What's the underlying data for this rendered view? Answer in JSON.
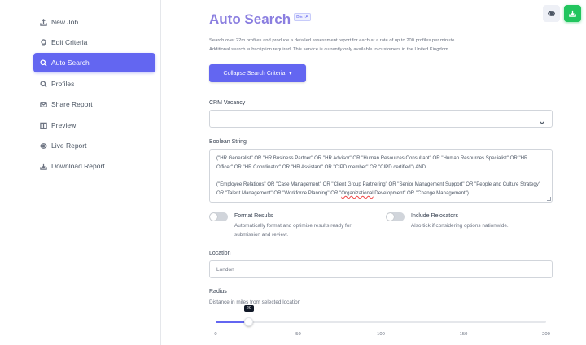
{
  "sidebar": {
    "items": [
      {
        "label": "New Job",
        "icon": "upload-icon"
      },
      {
        "label": "Edit Criteria",
        "icon": "lightbulb-icon"
      },
      {
        "label": "Auto Search",
        "icon": "search-icon",
        "active": true
      },
      {
        "label": "Profiles",
        "icon": "search-icon"
      },
      {
        "label": "Share Report",
        "icon": "mail-icon"
      },
      {
        "label": "Preview",
        "icon": "book-icon"
      },
      {
        "label": "Live Report",
        "icon": "eye-icon"
      },
      {
        "label": "Download Report",
        "icon": "download-icon"
      }
    ]
  },
  "header": {
    "title": "Auto Search",
    "badge": "BETA",
    "description_line1": "Search over 22m profiles and produce a detailed assessment report for each at a rate of up to 200 profiles per minute.",
    "description_line2": "Additional search subscription required. This service is currently only available to customers in the United Kingdom.",
    "collapse_label": "Collapse Search Criteria",
    "collapse_caret": "▾"
  },
  "form": {
    "crm_label": "CRM Vacancy",
    "crm_value": "",
    "boolean_label": "Boolean String",
    "boolean_para1": "(\"HR Generalist\" OR \"HR Business Partner\" OR \"HR Advisor\" OR \"Human Resources Consultant\" OR \"Human Resources Specialist\" OR \"HR Officer\" OR \"HR Coordinator\" OR \"HR Assistant\" OR \"CIPD member\" OR \"CIPD certified\") AND",
    "boolean_para2_a": "(\"Employee Relations\" OR \"Case Management\" OR \"Client Group Partnering\" OR \"Senior Management Support\" OR \"People and Culture Strategy\" OR \"Talent Management\" OR \"Workforce Planning\" OR \"",
    "boolean_para2_underlined": "Organizational",
    "boolean_para2_b": " Development\" OR \"Change Management\")",
    "format_results_title": "Format Results",
    "format_results_desc": "Automatically format and optimise results ready for submission and review.",
    "format_results_on": false,
    "relocators_title": "Include Relocators",
    "relocators_desc": "Also tick if considering options nationwide.",
    "relocators_on": false,
    "location_label": "Location",
    "location_placeholder": "London",
    "radius_label": "Radius",
    "radius_desc": "Distance in miles from selected location",
    "radius_value": 20,
    "radius_value_label": "20",
    "radius_min": 0,
    "radius_max": 200,
    "radius_ticks": [
      "0",
      "50",
      "100",
      "150",
      "200"
    ]
  },
  "top_actions": [
    {
      "icon": "eye-off-icon"
    },
    {
      "icon": "download-icon"
    }
  ],
  "colors": {
    "accent": "#6366f1",
    "title": "#8b7fe0",
    "success": "#22c55e"
  }
}
